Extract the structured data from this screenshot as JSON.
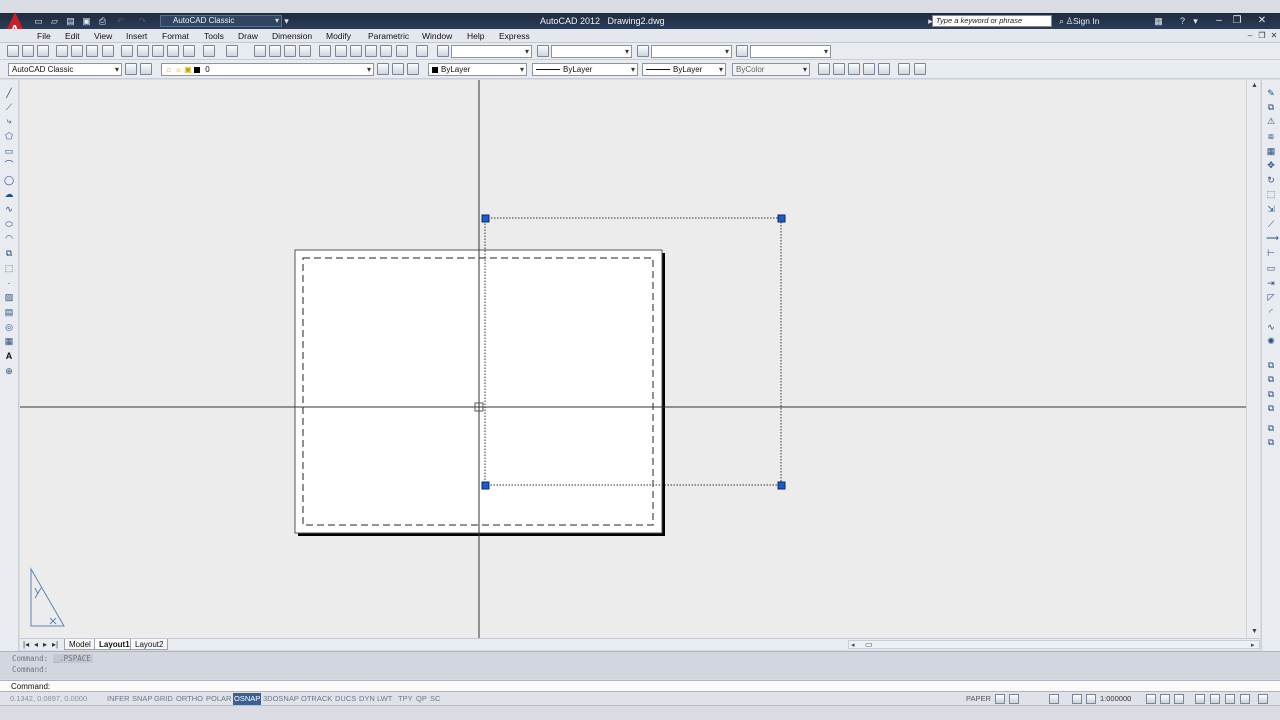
{
  "app": {
    "title": "AutoCAD 2012   Drawing2.dwg",
    "workspace": "AutoCAD Classic",
    "search_placeholder": "Type a keyword or phrase",
    "sign_in": "Sign In"
  },
  "menu": [
    "File",
    "Edit",
    "View",
    "Insert",
    "Format",
    "Tools",
    "Draw",
    "Dimension",
    "Modify",
    "Parametric",
    "Window",
    "Help",
    "Express"
  ],
  "toolbar2": {
    "workspace_combo": "AutoCAD Classic",
    "layer": "0",
    "color": "ByLayer",
    "linetype": "ByLayer",
    "lineweight": "ByLayer",
    "plotstyle": "ByColor"
  },
  "tabs": [
    "Model",
    "Layout1",
    "Layout2"
  ],
  "active_tab": "Layout1",
  "command_history": {
    "line1_prefix": "Command:",
    "line1_value": "_.PSPACE",
    "line2": "Command:"
  },
  "command_prompt": "Command:",
  "status": {
    "coords": "0.1342, 0.0897, 0.0000",
    "toggles": [
      {
        "label": "INFER",
        "on": false
      },
      {
        "label": "SNAP",
        "on": false
      },
      {
        "label": "GRID",
        "on": false
      },
      {
        "label": "ORTHO",
        "on": false
      },
      {
        "label": "POLAR",
        "on": false
      },
      {
        "label": "OSNAP",
        "on": true
      },
      {
        "label": "3DOSNAP",
        "on": false
      },
      {
        "label": "OTRACK",
        "on": false
      },
      {
        "label": "DUCS",
        "on": false
      },
      {
        "label": "DYN",
        "on": false
      },
      {
        "label": "LWT",
        "on": false
      },
      {
        "label": "TPY",
        "on": false
      },
      {
        "label": "QP",
        "on": false
      },
      {
        "label": "SC",
        "on": false
      }
    ],
    "space": "PAPER",
    "scale": "1:000000"
  },
  "colors": {
    "titlebar": "#1d2b3f",
    "canvas": "#ececec",
    "grip": "#1e5bc6",
    "osnap_active": "#3b5f8f"
  }
}
